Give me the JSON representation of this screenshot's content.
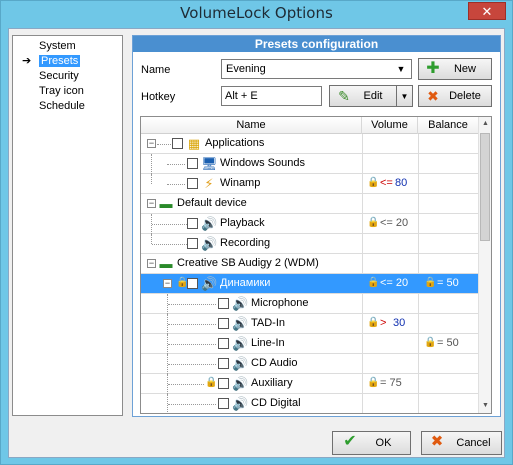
{
  "window": {
    "title": "VolumeLock Options",
    "close_label": "✕"
  },
  "nav": {
    "items": [
      {
        "label": "System",
        "selected": false
      },
      {
        "label": "Presets",
        "selected": true
      },
      {
        "label": "Security",
        "selected": false
      },
      {
        "label": "Tray icon",
        "selected": false
      },
      {
        "label": "Schedule",
        "selected": false
      }
    ]
  },
  "panel": {
    "title": "Presets configuration",
    "name_label": "Name",
    "name_value": "Evening",
    "hotkey_label": "Hotkey",
    "hotkey_value": "Alt + E",
    "new_label": "New",
    "edit_label": "Edit",
    "delete_label": "Delete"
  },
  "tree": {
    "columns": [
      "Name",
      "Volume",
      "Balance"
    ],
    "rows": [
      {
        "name": "Applications",
        "volume": "",
        "balance": ""
      },
      {
        "name": "Windows Sounds",
        "volume": "",
        "balance": ""
      },
      {
        "name": "Winamp",
        "volume_op": "<=",
        "volume_val": "80",
        "balance": ""
      },
      {
        "name": "Default device",
        "volume": "",
        "balance": ""
      },
      {
        "name": "Playback",
        "volume": "<= 20",
        "balance": ""
      },
      {
        "name": "Recording",
        "volume": "",
        "balance": ""
      },
      {
        "name": "Creative SB Audigy 2 (WDM)",
        "volume": "",
        "balance": ""
      },
      {
        "name": "Динамики",
        "volume": "<= 20",
        "balance": "= 50"
      },
      {
        "name": "Microphone",
        "volume": "",
        "balance": ""
      },
      {
        "name": "TAD-In",
        "volume_op": ">",
        "volume_val": "30",
        "balance": ""
      },
      {
        "name": "Line-In",
        "volume": "",
        "balance": "= 50"
      },
      {
        "name": "CD Audio",
        "volume": "",
        "balance": ""
      },
      {
        "name": "Auxiliary",
        "volume": "= 75",
        "balance": ""
      },
      {
        "name": "CD Digital",
        "volume": "",
        "balance": ""
      }
    ]
  },
  "footer": {
    "ok_label": "OK",
    "cancel_label": "Cancel"
  }
}
